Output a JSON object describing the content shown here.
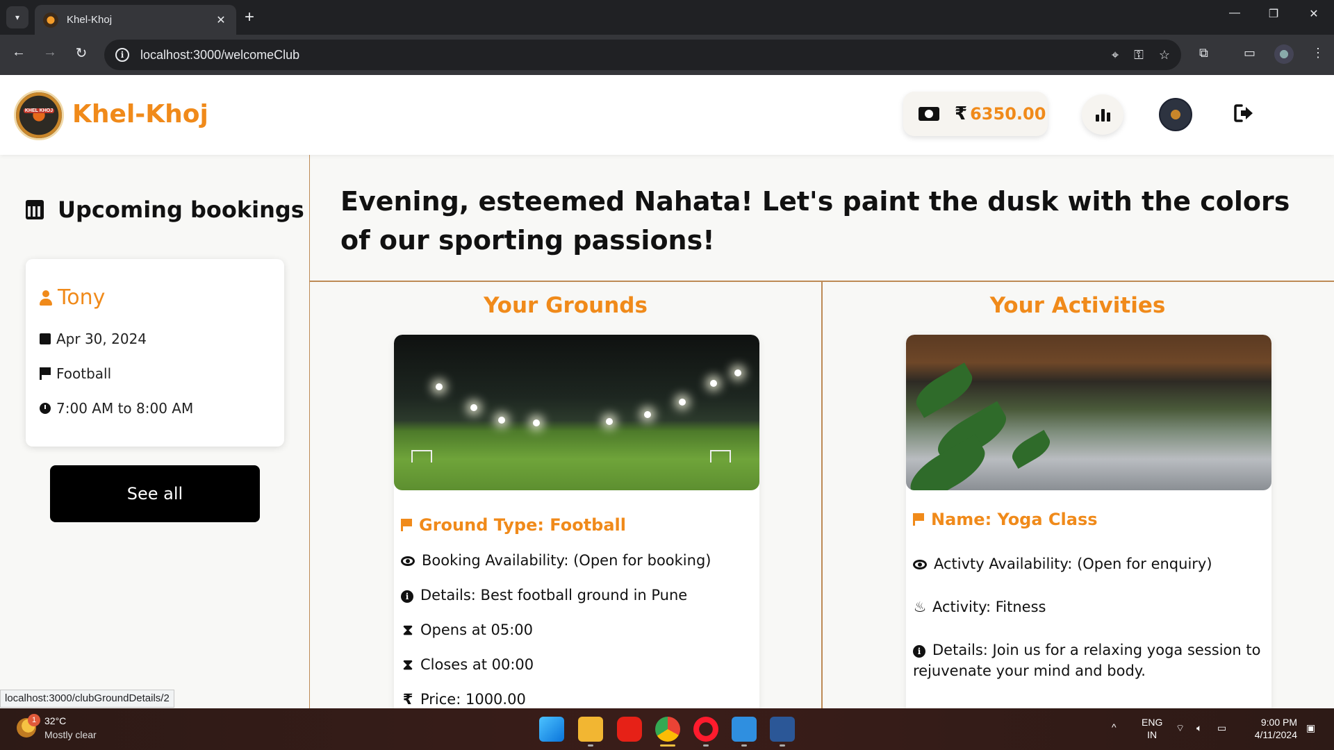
{
  "browser": {
    "tab_title": "Khel-Khoj",
    "url": "localhost:3000/welcomeClub",
    "status_url": "localhost:3000/clubGroundDetails/2"
  },
  "header": {
    "brand": "Khel-Khoj",
    "logo_text": "KHEL KHOJ",
    "currency_symbol": "₹",
    "balance": "6350.00"
  },
  "sidebar": {
    "title": "Upcoming bookings",
    "booking": {
      "name": "Tony",
      "date": "Apr 30, 2024",
      "sport": "Football",
      "time": "7:00 AM to 8:00 AM"
    },
    "see_all_label": "See all"
  },
  "main": {
    "greeting": "Evening, esteemed Nahata! Let's paint the dusk with the colors of our sporting passions!",
    "grounds": {
      "title": "Your Grounds",
      "card_title": "Ground Type: Football",
      "availability": "Booking Availability: (Open for booking)",
      "details": "Details: Best football ground in Pune",
      "opens": "Opens at 05:00",
      "closes": "Closes at 00:00",
      "price": "Price: 1000.00"
    },
    "activities": {
      "title": "Your Activities",
      "card_title": "Name: Yoga Class",
      "availability": "Activty Availability: (Open for enquiry)",
      "activity": "Activity: Fitness",
      "details": "Details: Join us for a relaxing yoga session to rejuvenate your mind and body."
    }
  },
  "taskbar": {
    "weather_badge": "1",
    "temperature": "32°C",
    "weather": "Mostly clear",
    "lang_top": "ENG",
    "lang_bottom": "IN",
    "time": "9:00 PM",
    "date": "4/11/2024"
  },
  "colors": {
    "accent": "#f08a1a",
    "divider": "#bd8a55",
    "button": "#000000"
  }
}
